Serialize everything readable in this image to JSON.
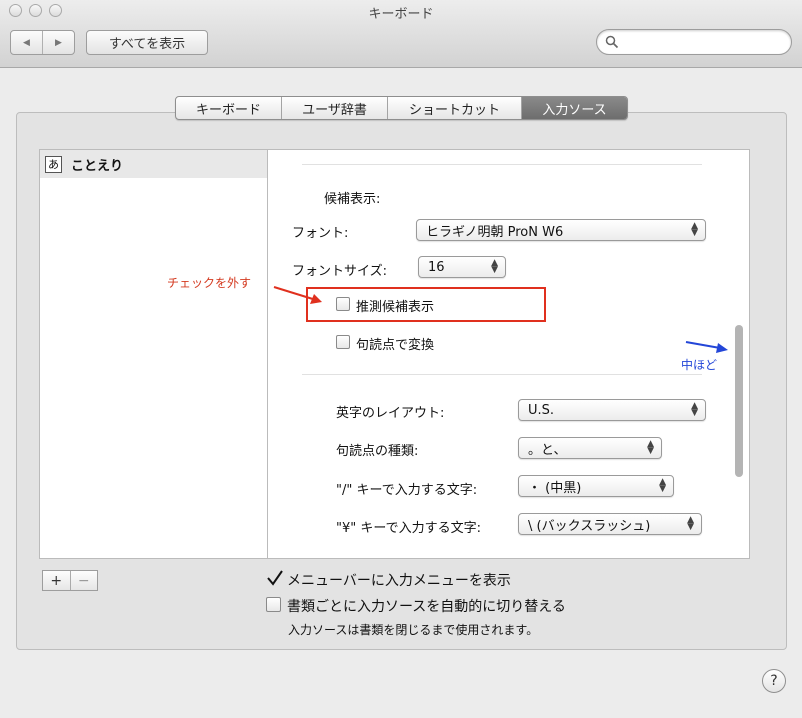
{
  "window": {
    "title": "キーボード",
    "show_all_label": "すべてを表示",
    "back_glyph": "◀",
    "forward_glyph": "▶",
    "search_placeholder": ""
  },
  "tabs": [
    {
      "label": "キーボード",
      "selected": false
    },
    {
      "label": "ユーザ辞書",
      "selected": false
    },
    {
      "label": "ショートカット",
      "selected": false
    },
    {
      "label": "入力ソース",
      "selected": true
    }
  ],
  "source_list": {
    "items": [
      {
        "icon_text": "あ",
        "label": "ことえり",
        "selected": true
      }
    ]
  },
  "options": {
    "candidate_heading": "候補表示:",
    "font_label": "フォント:",
    "font_value": "ヒラギノ明朝 ProN W6",
    "font_size_label": "フォントサイズ:",
    "font_size_value": "16",
    "predictive_label": "推測候補表示",
    "predictive_checked": false,
    "punct_convert_label": "句読点で変換",
    "punct_convert_checked": false,
    "layout_label": "英字のレイアウト:",
    "layout_value": "U.S.",
    "punct_type_label": "句読点の種類:",
    "punct_type_value": "。と、",
    "slash_label": "\"/\" キーで入力する文字:",
    "slash_value": "・ (中黒)",
    "yen_label": "\"¥\" キーで入力する文字:",
    "yen_value": "\\ (バックスラッシュ)"
  },
  "annotations": {
    "red_note": "チェックを外す",
    "blue_note": "中ほど",
    "red_color": "#e0301e",
    "blue_color": "#2346d8"
  },
  "bottom": {
    "add_label": "+",
    "remove_label": "−",
    "menu_opt_label": "メニューバーに入力メニューを表示",
    "menu_opt_checked": true,
    "auto_switch_label": "書類ごとに入力ソースを自動的に切り替える",
    "auto_switch_checked": false,
    "auto_switch_note": "入力ソースは書類を閉じるまで使用されます。",
    "help_label": "?"
  }
}
